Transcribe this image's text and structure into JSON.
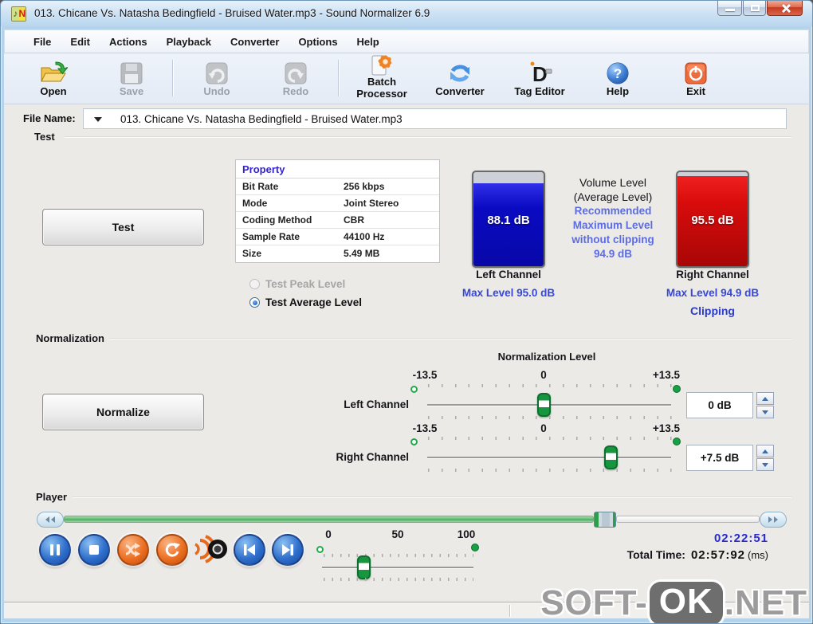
{
  "window": {
    "title": "013. Chicane Vs. Natasha Bedingfield  -  Bruised Water.mp3 - Sound Normalizer 6.9",
    "icon_left_glyph": "♪",
    "icon_right_glyph": "N"
  },
  "menu": {
    "items": [
      "File",
      "Edit",
      "Actions",
      "Playback",
      "Converter",
      "Options",
      "Help"
    ]
  },
  "toolbar": {
    "open": "Open",
    "save": "Save",
    "undo": "Undo",
    "redo": "Redo",
    "batch_line1": "Batch",
    "batch_line2": "Processor",
    "converter": "Converter",
    "tag_editor": "Tag Editor",
    "help": "Help",
    "exit": "Exit",
    "disabled_items": [
      "Save",
      "Undo",
      "Redo"
    ],
    "icons": [
      "open-folder-icon",
      "save-floppy-icon",
      "undo-icon",
      "redo-icon",
      "batch-gear-document-icon",
      "converter-refresh-icon",
      "tag-editor-icon",
      "help-question-icon",
      "exit-power-icon"
    ]
  },
  "file_bar": {
    "label": "File Name:",
    "value": "013. Chicane Vs. Natasha Bedingfield  -  Bruised Water.mp3"
  },
  "test": {
    "group_label": "Test",
    "button": "Test",
    "table": {
      "header": "Property",
      "rows": [
        {
          "label": "Bit Rate",
          "value": "256 kbps"
        },
        {
          "label": "Mode",
          "value": "Joint Stereo"
        },
        {
          "label": "Coding Method",
          "value": "CBR"
        },
        {
          "label": "Sample Rate",
          "value": "44100 Hz"
        },
        {
          "label": "Size",
          "value": "5.49 MB"
        }
      ]
    },
    "radio_peak": {
      "label": "Test Peak Level",
      "selected": false,
      "disabled": true
    },
    "radio_average": {
      "label": "Test Average Level",
      "selected": true
    },
    "left_meter": {
      "value": "88.1 dB",
      "label": "Left Channel",
      "max": "Max Level 95.0 dB",
      "fill_percent": 88,
      "color": "#0a0ac2"
    },
    "right_meter": {
      "value": "95.5 dB",
      "label": "Right Channel",
      "max": "Max Level 94.9 dB",
      "clipping": "Clipping",
      "fill_percent": 96,
      "color": "#d80c0c"
    },
    "volume_info": {
      "line1": "Volume Level",
      "line2": "(Average Level)",
      "rec1": "Recommended",
      "rec2": "Maximum Level",
      "rec3": "without clipping",
      "rec4": "94.9 dB"
    }
  },
  "normalization": {
    "group_label": "Normalization",
    "button": "Normalize",
    "title": "Normalization Level",
    "left": {
      "label": "Left Channel",
      "min": "-13.5",
      "zero": "0",
      "max": "+13.5",
      "value": "0 dB"
    },
    "right": {
      "label": "Right Channel",
      "min": "-13.5",
      "zero": "0",
      "max": "+13.5",
      "value": "+7.5 dB"
    }
  },
  "player": {
    "group_label": "Player",
    "progress_percent": 74,
    "buttons": [
      "pause-icon",
      "stop-icon",
      "shuffle-icon",
      "repeat-icon",
      "speaker-icon",
      "previous-track-icon",
      "next-track-icon"
    ],
    "volume_scale": {
      "v0": "0",
      "v50": "50",
      "v100": "100"
    },
    "volume_percent": 27,
    "time_current": "02:22:51",
    "total_label": "Total Time:",
    "total_value": "02:57:92",
    "total_unit": "(ms)"
  },
  "watermark": {
    "part1": "SOFT-",
    "part2": "OK",
    "part3": ".NET"
  },
  "colors": {
    "accent_blue_text": "#3747d6",
    "recommend_blue": "#5d6ce0",
    "meter_blue": "#0a0ac2",
    "meter_red": "#d80c0c",
    "slider_green": "#17953f",
    "time_blue": "#2a2ad0",
    "titlebar_blue": "#cfe3f4"
  }
}
